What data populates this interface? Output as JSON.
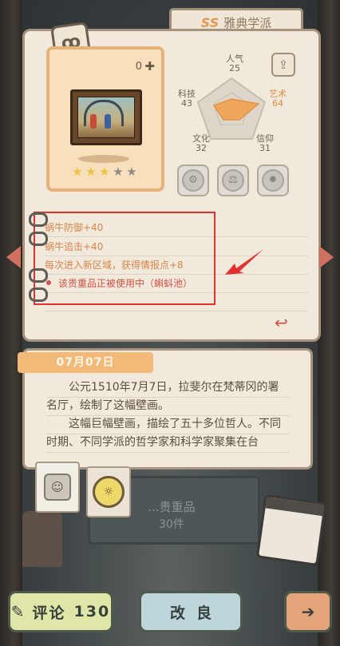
{
  "header": {
    "rarity": "SS",
    "title": "雅典学派"
  },
  "artifact": {
    "count": "0",
    "stars": {
      "filled": 3,
      "total": 5
    }
  },
  "stats": {
    "popularity": {
      "label": "人气",
      "value": "25"
    },
    "art": {
      "label": "艺术",
      "value": "64"
    },
    "faith": {
      "label": "信仰",
      "value": "31"
    },
    "culture": {
      "label": "文化",
      "value": "32"
    },
    "tech": {
      "label": "科技",
      "value": "43"
    }
  },
  "effects": [
    "蜗牛防御+40",
    "蜗牛追击+40",
    "每次进入新区域，获得情报点+8"
  ],
  "usage_note": "该贵重品正被使用中（蝌蚪池）",
  "diary": {
    "date": "07月07日",
    "paragraphs": [
      "公元1510年7月7日，拉斐尔在梵蒂冈的署名厅，绘制了这幅壁画。",
      "这幅巨幅壁画，描绘了五十多位哲人。不同时期、不同学派的哲学家和科学家聚集在台"
    ]
  },
  "shelf": {
    "label": "...贵重品",
    "count": "30件"
  },
  "buttons": {
    "comment_label": "评论",
    "comment_count": "130",
    "improve_label": "改良"
  },
  "colors": {
    "accent_orange": "#e58a3c",
    "effect_text": "#d9844b",
    "highlight_box": "#e53030",
    "card_bg": "#f1eadc"
  }
}
